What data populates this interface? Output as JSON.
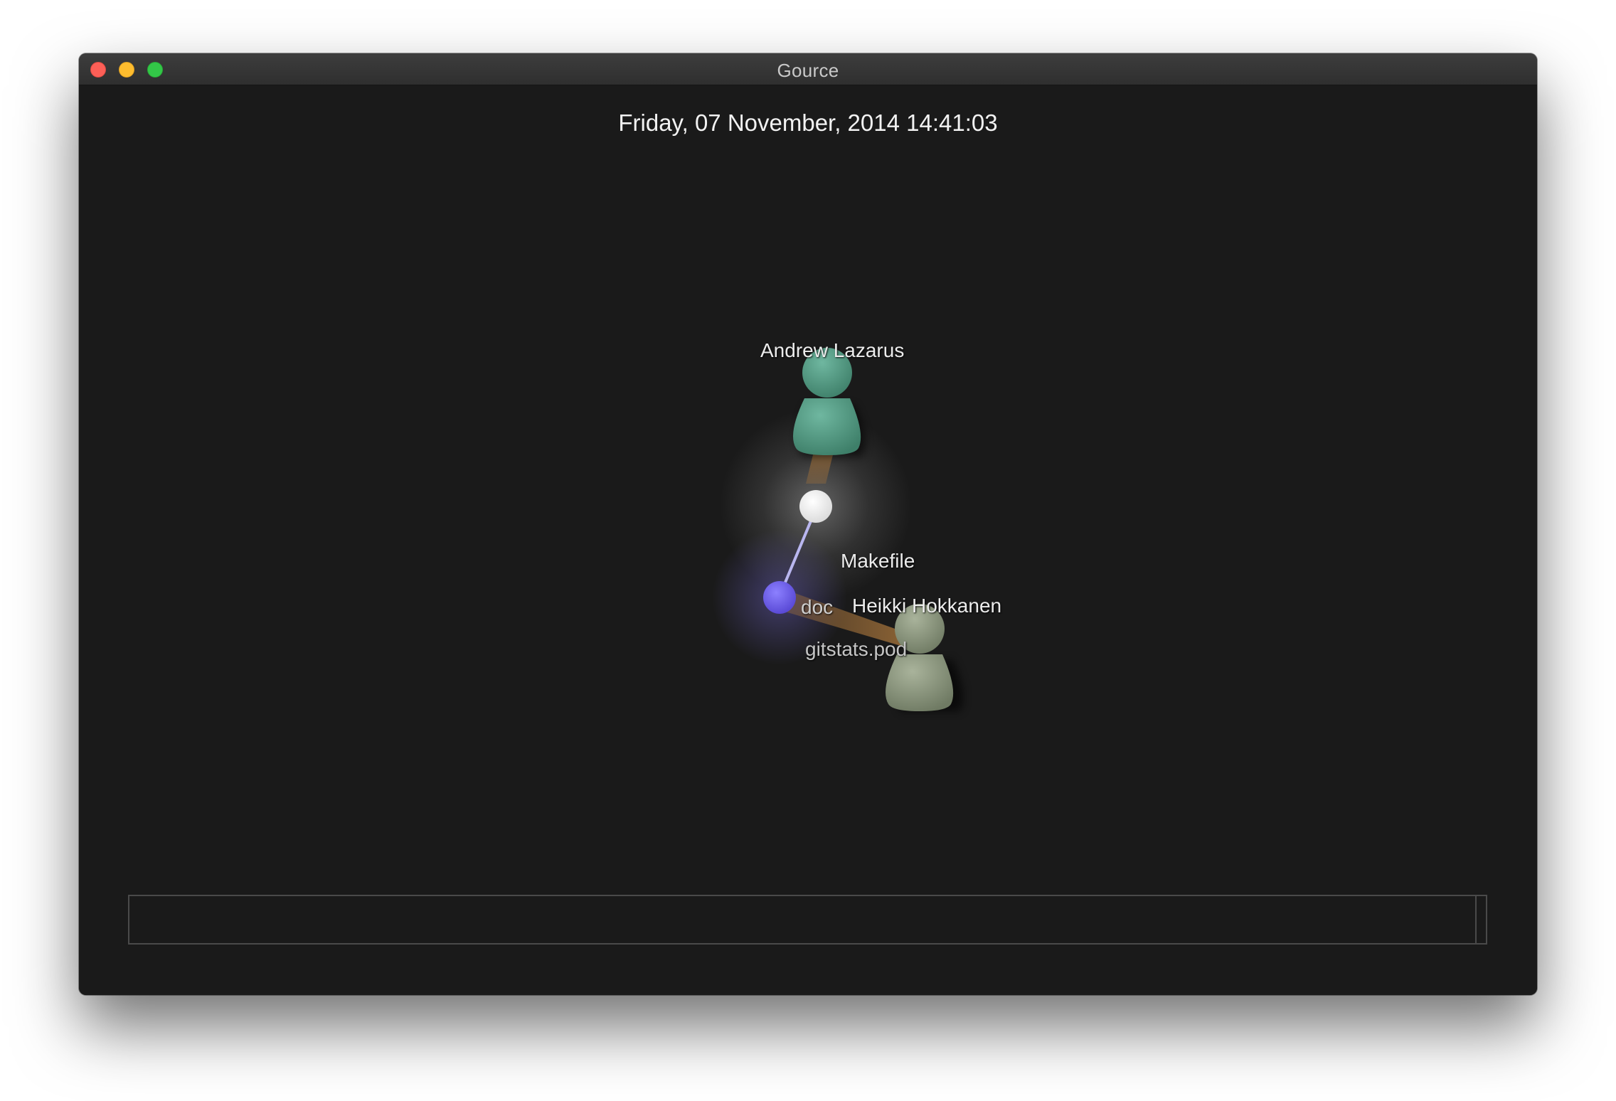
{
  "window": {
    "title": "Gource"
  },
  "visualization": {
    "date": "Friday, 07 November, 2014 14:41:03",
    "users": [
      {
        "name": "Andrew Lazarus",
        "color": "#5aa08a"
      },
      {
        "name": "Heikki Hokkanen",
        "color": "#8f9a82"
      }
    ],
    "files": [
      {
        "name": "Makefile",
        "color": "#ffffff"
      },
      {
        "name": "gitstats.pod",
        "color": "#6a5be0"
      }
    ],
    "directories": [
      {
        "name": "doc"
      }
    ],
    "beam_color": "#a0703a",
    "edge_color": "#b9b6ef"
  },
  "timeline": {
    "progress": 0.993
  }
}
